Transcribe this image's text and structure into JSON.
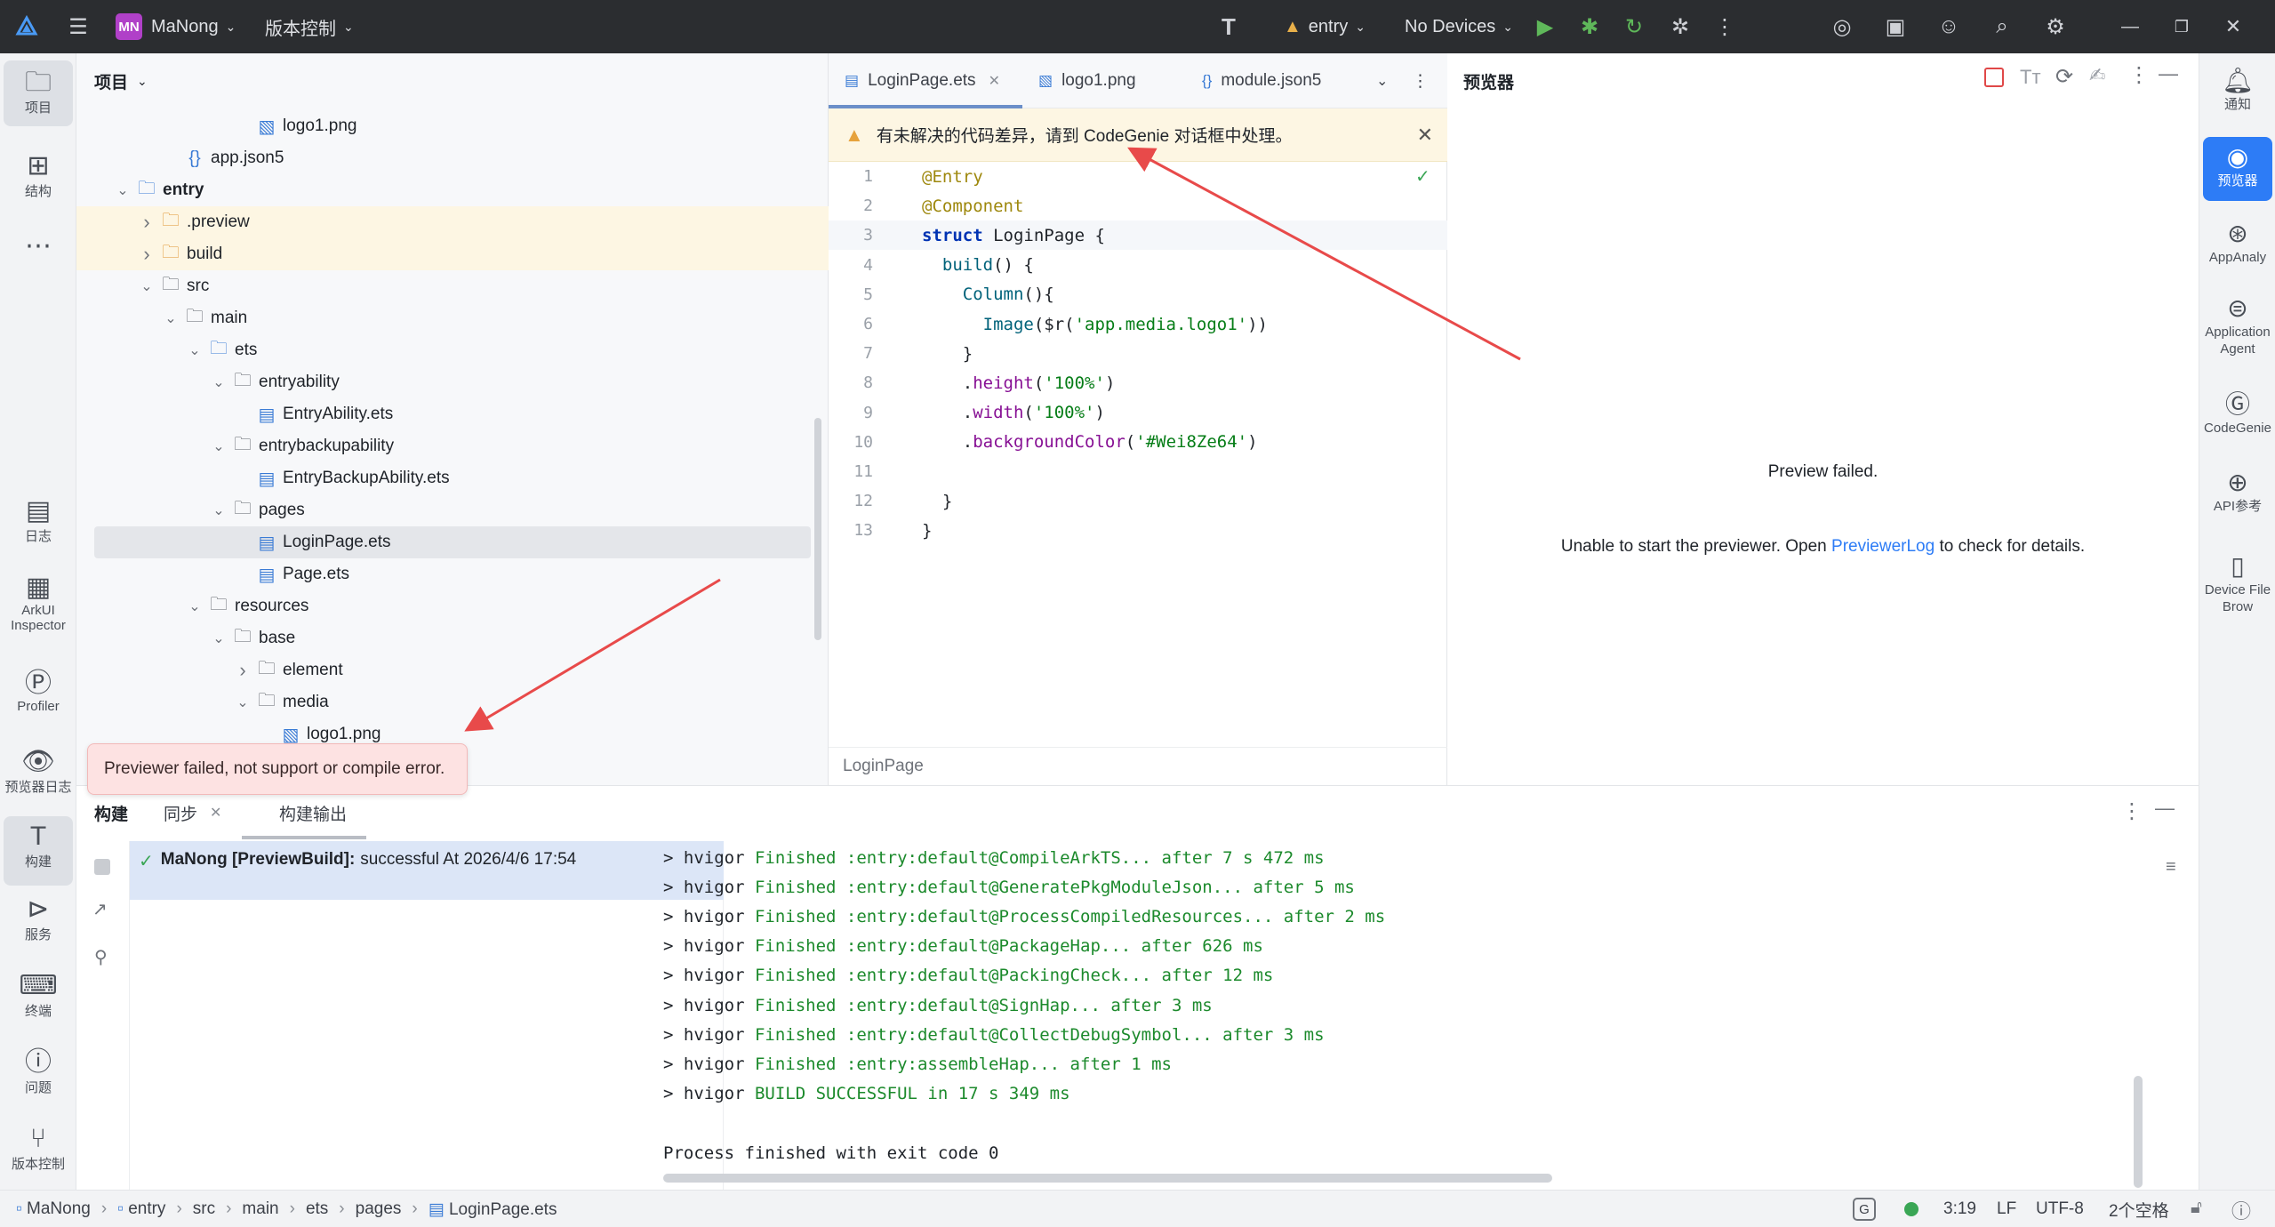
{
  "titlebar": {
    "project_badge": "MN",
    "project_name": "MaNong",
    "vcs_label": "版本控制",
    "module": "entry",
    "device": "No Devices"
  },
  "left_tools": [
    {
      "label": "项目",
      "icon": "folder-icon"
    },
    {
      "label": "结构",
      "icon": "structure-icon"
    },
    {
      "label": "日志",
      "icon": "log-icon"
    },
    {
      "label": "ArkUI Inspector",
      "icon": "inspector-icon"
    },
    {
      "label": "Profiler",
      "icon": "profiler-icon"
    },
    {
      "label": "预览器日志",
      "icon": "preview-log-icon"
    },
    {
      "label": "构建",
      "icon": "build-icon"
    },
    {
      "label": "服务",
      "icon": "services-icon"
    },
    {
      "label": "终端",
      "icon": "terminal-icon"
    },
    {
      "label": "问题",
      "icon": "problems-icon"
    },
    {
      "label": "版本控制",
      "icon": "vcs-icon"
    }
  ],
  "project_panel": {
    "title": "项目",
    "tree": [
      {
        "label": "logo1.png",
        "type": "image"
      },
      {
        "label": "app.json5",
        "type": "json"
      },
      {
        "label": "entry",
        "type": "module"
      },
      {
        "label": ".preview",
        "type": "folder-orange"
      },
      {
        "label": "build",
        "type": "folder-orange"
      },
      {
        "label": "src",
        "type": "folder"
      },
      {
        "label": "main",
        "type": "folder"
      },
      {
        "label": "ets",
        "type": "folder-blue"
      },
      {
        "label": "entryability",
        "type": "folder"
      },
      {
        "label": "EntryAbility.ets",
        "type": "ets"
      },
      {
        "label": "entrybackupability",
        "type": "folder"
      },
      {
        "label": "EntryBackupAbility.ets",
        "type": "ets"
      },
      {
        "label": "pages",
        "type": "folder"
      },
      {
        "label": "LoginPage.ets",
        "type": "ets"
      },
      {
        "label": "Page.ets",
        "type": "ets"
      },
      {
        "label": "resources",
        "type": "folder"
      },
      {
        "label": "base",
        "type": "folder"
      },
      {
        "label": "element",
        "type": "folder"
      },
      {
        "label": "media",
        "type": "folder"
      },
      {
        "label": "logo1.png",
        "type": "image"
      }
    ],
    "tooltip": "Previewer failed, not support or compile error."
  },
  "editor": {
    "tabs": [
      "LoginPage.ets",
      "logo1.png",
      "module.json5"
    ],
    "banner_text": "有未解决的代码差异，请到 CodeGenie 对话框中处理。",
    "lines": [
      {
        "n": "1",
        "text": "@Entry"
      },
      {
        "n": "2",
        "text": "@Component"
      },
      {
        "n": "3",
        "text": "struct LoginPage {"
      },
      {
        "n": "4",
        "text": "  build() {"
      },
      {
        "n": "5",
        "text": "    Column(){"
      },
      {
        "n": "6",
        "text": "      Image($r('app.media.logo1'))"
      },
      {
        "n": "7",
        "text": "    }"
      },
      {
        "n": "8",
        "text": "    .height('100%')"
      },
      {
        "n": "9",
        "text": "    .width('100%')"
      },
      {
        "n": "10",
        "text": "    .backgroundColor('#Wei8Ze64')"
      },
      {
        "n": "11",
        "text": ""
      },
      {
        "n": "12",
        "text": "  }"
      },
      {
        "n": "13",
        "text": "}"
      }
    ],
    "breadcrumb": "LoginPage"
  },
  "preview": {
    "title": "预览器",
    "failed": "Preview failed.",
    "msg_before": "Unable to start the previewer. Open ",
    "msg_link": "PreviewerLog",
    "msg_after": " to check for details."
  },
  "right_tools": [
    {
      "label": "通知",
      "icon": "bell-icon"
    },
    {
      "label": "预览器",
      "icon": "eye-icon"
    },
    {
      "label": "AppAnaly",
      "icon": "app-analyzer-icon"
    },
    {
      "label": "Application Agent",
      "icon": "agent-icon"
    },
    {
      "label": "CodeGenie",
      "icon": "codegenie-icon"
    },
    {
      "label": "API参考",
      "icon": "api-icon"
    },
    {
      "label": "Device File Brow",
      "icon": "device-icon"
    }
  ],
  "build_panel": {
    "tabs": [
      "构建",
      "同步",
      "构建输出"
    ],
    "task_name": "MaNong [PreviewBuild]:",
    "task_status": "successful At 2026/4/6 17:54",
    "output": [
      {
        "prefix": "> hvigor ",
        "msg": "Finished :entry:default@CompileArkTS... after 7 s 472 ms"
      },
      {
        "prefix": "> hvigor ",
        "msg": "Finished :entry:default@GeneratePkgModuleJson... after 5 ms"
      },
      {
        "prefix": "> hvigor ",
        "msg": "Finished :entry:default@ProcessCompiledResources... after 2 ms"
      },
      {
        "prefix": "> hvigor ",
        "msg": "Finished :entry:default@PackageHap... after 626 ms"
      },
      {
        "prefix": "> hvigor ",
        "msg": "Finished :entry:default@PackingCheck... after 12 ms"
      },
      {
        "prefix": "> hvigor ",
        "msg": "Finished :entry:default@SignHap... after 3 ms"
      },
      {
        "prefix": "> hvigor ",
        "msg": "Finished :entry:default@CollectDebugSymbol... after 3 ms"
      },
      {
        "prefix": "> hvigor ",
        "msg": "Finished :entry:assembleHap... after 1 ms"
      },
      {
        "prefix": "> hvigor ",
        "msg": "BUILD SUCCESSFUL in 17 s 349 ms"
      }
    ],
    "exit_line": "Process finished with exit code 0"
  },
  "statusbar": {
    "crumbs": [
      "MaNong",
      "entry",
      "src",
      "main",
      "ets",
      "pages",
      "LoginPage.ets"
    ],
    "position": "3:19",
    "line_sep": "LF",
    "encoding": "UTF-8",
    "indent": "2个空格"
  }
}
